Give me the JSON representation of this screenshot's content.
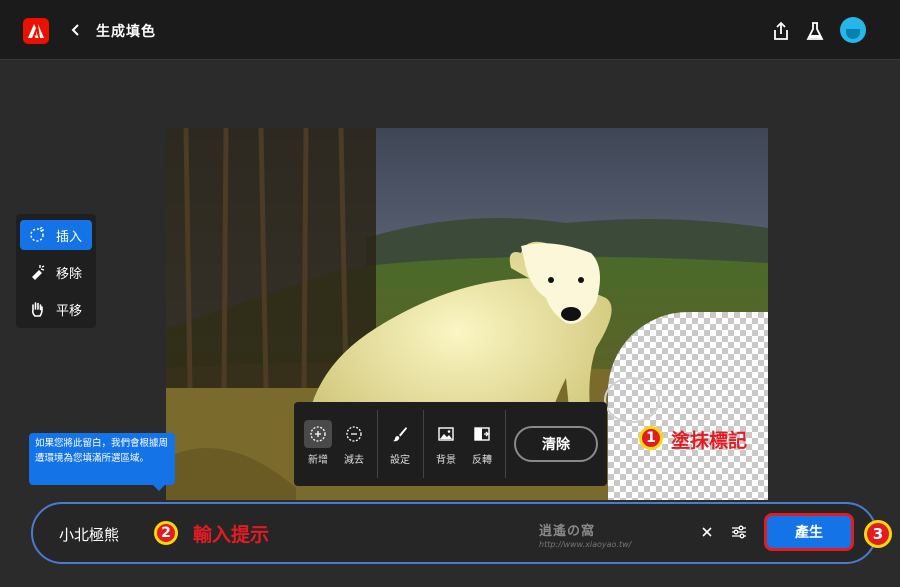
{
  "header": {
    "title": "生成填色",
    "logo_icon": "adobe-logo-icon",
    "back_icon": "chevron-left-icon",
    "share_icon": "share-icon",
    "labs_icon": "beaker-icon",
    "avatar_icon": "avatar"
  },
  "side_tools": [
    {
      "label": "插入",
      "icon": "insert-icon",
      "active": true
    },
    {
      "label": "移除",
      "icon": "remove-icon",
      "active": false
    },
    {
      "label": "平移",
      "icon": "hand-icon",
      "active": false
    }
  ],
  "tip": {
    "text": "如果您將此留白，我們會根據周遭環境為您填滿所選區域。"
  },
  "brush_toolbar": {
    "items": [
      {
        "label": "新增",
        "icon": "add-brush-icon",
        "active": true
      },
      {
        "label": "減去",
        "icon": "subtract-brush-icon",
        "active": false
      },
      {
        "label": "設定",
        "icon": "brush-icon",
        "active": false
      },
      {
        "label": "背景",
        "icon": "image-background-icon",
        "active": false
      },
      {
        "label": "反轉",
        "icon": "invert-icon",
        "active": false
      }
    ],
    "clear_label": "清除"
  },
  "annotations": {
    "one_number": "1",
    "one_label": "塗抹標記",
    "two_number": "2",
    "two_label": "輸入提示",
    "three_number": "3"
  },
  "prompt": {
    "value": "小北極熊",
    "watermark": "逍遙の窩",
    "watermark_url": "http://www.xiaoyao.tw/",
    "clear_icon": "close-icon",
    "settings_icon": "sliders-icon",
    "generate_label": "產生"
  },
  "colors": {
    "accent": "#1473e6",
    "annotation_red": "#e31b23",
    "annotation_yellow": "#f5d90b",
    "adobe_red": "#eb1000"
  }
}
